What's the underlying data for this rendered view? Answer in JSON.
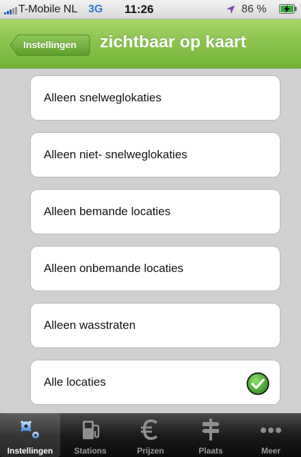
{
  "status_bar": {
    "carrier": "T-Mobile NL",
    "network": "3G",
    "time": "11:26",
    "battery": "86 %"
  },
  "nav": {
    "back_label": "Instellingen",
    "title": "zichtbaar op kaart"
  },
  "options": [
    {
      "label": "Alleen snelweglokaties",
      "selected": false
    },
    {
      "label": "Alleen niet- snelweglokaties",
      "selected": false
    },
    {
      "label": "Alleen bemande locaties",
      "selected": false
    },
    {
      "label": "Alleen onbemande locaties",
      "selected": false
    },
    {
      "label": "Alleen wasstraten",
      "selected": false
    },
    {
      "label": "Alle locaties",
      "selected": true
    }
  ],
  "tabs": [
    {
      "label": "Instellingen",
      "icon": "gears-icon",
      "active": true
    },
    {
      "label": "Stations",
      "icon": "fuel-pump-icon",
      "active": false
    },
    {
      "label": "Prijzen",
      "icon": "euro-icon",
      "active": false
    },
    {
      "label": "Plaats",
      "icon": "signpost-icon",
      "active": false
    },
    {
      "label": "Meer",
      "icon": "more-dots-icon",
      "active": false
    }
  ],
  "colors": {
    "nav_green": "#8cc44e",
    "check_green": "#4fb130",
    "network_blue": "#2a78c9"
  }
}
